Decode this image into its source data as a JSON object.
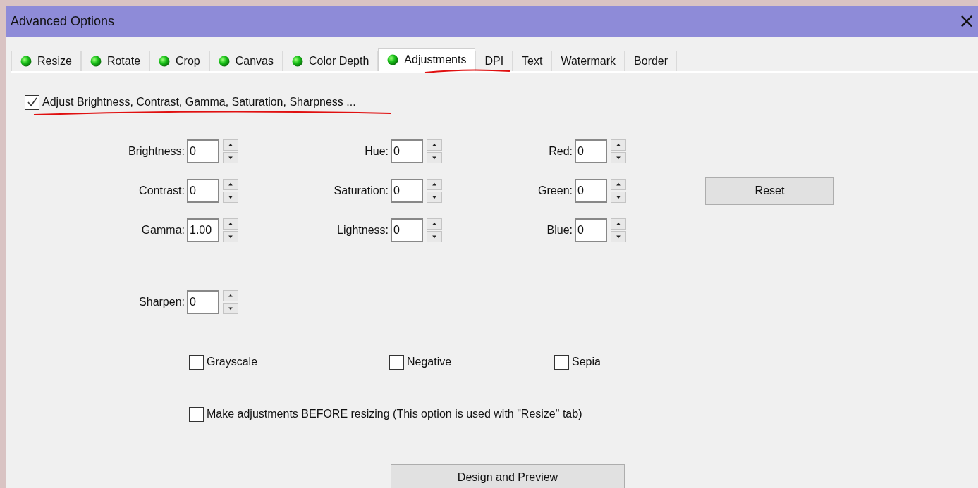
{
  "window": {
    "title": "Advanced Options",
    "close": "×"
  },
  "tabs": [
    {
      "label": "Resize",
      "dot": true,
      "selected": false
    },
    {
      "label": "Rotate",
      "dot": true,
      "selected": false
    },
    {
      "label": "Crop",
      "dot": true,
      "selected": false
    },
    {
      "label": "Canvas",
      "dot": true,
      "selected": false
    },
    {
      "label": "Color Depth",
      "dot": true,
      "selected": false
    },
    {
      "label": "Adjustments",
      "dot": true,
      "selected": true
    },
    {
      "label": "DPI",
      "dot": false,
      "selected": false
    },
    {
      "label": "Text",
      "dot": false,
      "selected": false
    },
    {
      "label": "Watermark",
      "dot": false,
      "selected": false
    },
    {
      "label": "Border",
      "dot": false,
      "selected": false
    }
  ],
  "enable_checkbox": {
    "label": "Adjust Brightness, Contrast, Gamma, Saturation, Sharpness ...",
    "checked": true
  },
  "spin_rows": [
    [
      {
        "label": "Brightness:",
        "value": "0"
      },
      {
        "label": "Hue:",
        "value": "0"
      },
      {
        "label": "Red:",
        "value": "0"
      }
    ],
    [
      {
        "label": "Contrast:",
        "value": "0"
      },
      {
        "label": "Saturation:",
        "value": "0"
      },
      {
        "label": "Green:",
        "value": "0"
      }
    ],
    [
      {
        "label": "Gamma:",
        "value": "1.00"
      },
      {
        "label": "Lightness:",
        "value": "0"
      },
      {
        "label": "Blue:",
        "value": "0"
      }
    ]
  ],
  "reset_button": "Reset",
  "sharpen": {
    "label": "Sharpen:",
    "value": "0"
  },
  "effects": [
    {
      "label": "Grayscale",
      "checked": false
    },
    {
      "label": "Negative",
      "checked": false
    },
    {
      "label": "Sepia",
      "checked": false
    }
  ],
  "before_resize_checkbox": {
    "label": "Make adjustments BEFORE resizing (This option is used with \"Resize\" tab)",
    "checked": false
  },
  "design_button": "Design and Preview"
}
